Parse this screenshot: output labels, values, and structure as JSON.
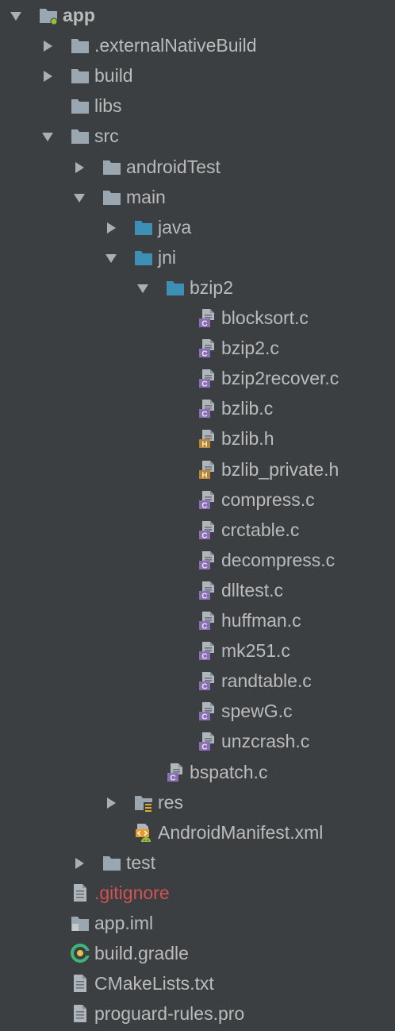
{
  "tree": {
    "nodes": [
      {
        "id": "app",
        "label": "app",
        "depth": 0,
        "arrow": "down",
        "icon": "module-folder-icon",
        "bold": true
      },
      {
        "id": "externalNativeBuild",
        "label": ".externalNativeBuild",
        "depth": 1,
        "arrow": "right",
        "icon": "folder-icon"
      },
      {
        "id": "build",
        "label": "build",
        "depth": 1,
        "arrow": "right",
        "icon": "folder-icon"
      },
      {
        "id": "libs",
        "label": "libs",
        "depth": 1,
        "arrow": "none",
        "icon": "folder-icon"
      },
      {
        "id": "src",
        "label": "src",
        "depth": 1,
        "arrow": "down",
        "icon": "folder-icon"
      },
      {
        "id": "androidTest",
        "label": "androidTest",
        "depth": 2,
        "arrow": "right",
        "icon": "folder-icon"
      },
      {
        "id": "main",
        "label": "main",
        "depth": 2,
        "arrow": "down",
        "icon": "folder-icon"
      },
      {
        "id": "java",
        "label": "java",
        "depth": 3,
        "arrow": "right",
        "icon": "source-folder-icon"
      },
      {
        "id": "jni",
        "label": "jni",
        "depth": 3,
        "arrow": "down",
        "icon": "source-folder-icon"
      },
      {
        "id": "bzip2",
        "label": "bzip2",
        "depth": 4,
        "arrow": "down",
        "icon": "source-folder-icon"
      },
      {
        "id": "blocksort_c",
        "label": "blocksort.c",
        "depth": 5,
        "arrow": "none",
        "icon": "c-file-icon"
      },
      {
        "id": "bzip2_c",
        "label": "bzip2.c",
        "depth": 5,
        "arrow": "none",
        "icon": "c-file-icon"
      },
      {
        "id": "bzip2recover_c",
        "label": "bzip2recover.c",
        "depth": 5,
        "arrow": "none",
        "icon": "c-file-icon"
      },
      {
        "id": "bzlib_c",
        "label": "bzlib.c",
        "depth": 5,
        "arrow": "none",
        "icon": "c-file-icon"
      },
      {
        "id": "bzlib_h",
        "label": "bzlib.h",
        "depth": 5,
        "arrow": "none",
        "icon": "h-file-icon"
      },
      {
        "id": "bzlib_private_h",
        "label": "bzlib_private.h",
        "depth": 5,
        "arrow": "none",
        "icon": "h-file-icon"
      },
      {
        "id": "compress_c",
        "label": "compress.c",
        "depth": 5,
        "arrow": "none",
        "icon": "c-file-icon"
      },
      {
        "id": "crctable_c",
        "label": "crctable.c",
        "depth": 5,
        "arrow": "none",
        "icon": "c-file-icon"
      },
      {
        "id": "decompress_c",
        "label": "decompress.c",
        "depth": 5,
        "arrow": "none",
        "icon": "c-file-icon"
      },
      {
        "id": "dlltest_c",
        "label": "dlltest.c",
        "depth": 5,
        "arrow": "none",
        "icon": "c-file-icon"
      },
      {
        "id": "huffman_c",
        "label": "huffman.c",
        "depth": 5,
        "arrow": "none",
        "icon": "c-file-icon"
      },
      {
        "id": "mk251_c",
        "label": "mk251.c",
        "depth": 5,
        "arrow": "none",
        "icon": "c-file-icon"
      },
      {
        "id": "randtable_c",
        "label": "randtable.c",
        "depth": 5,
        "arrow": "none",
        "icon": "c-file-icon"
      },
      {
        "id": "spewG_c",
        "label": "spewG.c",
        "depth": 5,
        "arrow": "none",
        "icon": "c-file-icon"
      },
      {
        "id": "unzcrash_c",
        "label": "unzcrash.c",
        "depth": 5,
        "arrow": "none",
        "icon": "c-file-icon"
      },
      {
        "id": "bspatch_c",
        "label": "bspatch.c",
        "depth": 4,
        "arrow": "none",
        "icon": "c-file-icon"
      },
      {
        "id": "res",
        "label": "res",
        "depth": 3,
        "arrow": "right",
        "icon": "resource-folder-icon"
      },
      {
        "id": "android_manifest",
        "label": "AndroidManifest.xml",
        "depth": 3,
        "arrow": "none",
        "icon": "android-manifest-icon"
      },
      {
        "id": "test",
        "label": "test",
        "depth": 2,
        "arrow": "right",
        "icon": "folder-icon"
      },
      {
        "id": "gitignore",
        "label": ".gitignore",
        "depth": 1,
        "arrow": "none",
        "icon": "text-file-icon",
        "ignored": true
      },
      {
        "id": "app_iml",
        "label": "app.iml",
        "depth": 1,
        "arrow": "none",
        "icon": "iml-file-icon"
      },
      {
        "id": "build_gradle",
        "label": "build.gradle",
        "depth": 1,
        "arrow": "none",
        "icon": "gradle-icon"
      },
      {
        "id": "cmakelists",
        "label": "CMakeLists.txt",
        "depth": 1,
        "arrow": "none",
        "icon": "text-file-icon"
      },
      {
        "id": "proguard",
        "label": "proguard-rules.pro",
        "depth": 1,
        "arrow": "none",
        "icon": "text-file-icon"
      }
    ]
  },
  "colors": {
    "background": "#3c3f41",
    "text": "#bbbbbb",
    "ignored_text": "#d25252",
    "folder": "#9aa7b0",
    "source_folder": "#3d8fb6",
    "c_badge": "#8a6fb7",
    "h_badge": "#b8862e",
    "gradle": "#3fb47a"
  }
}
